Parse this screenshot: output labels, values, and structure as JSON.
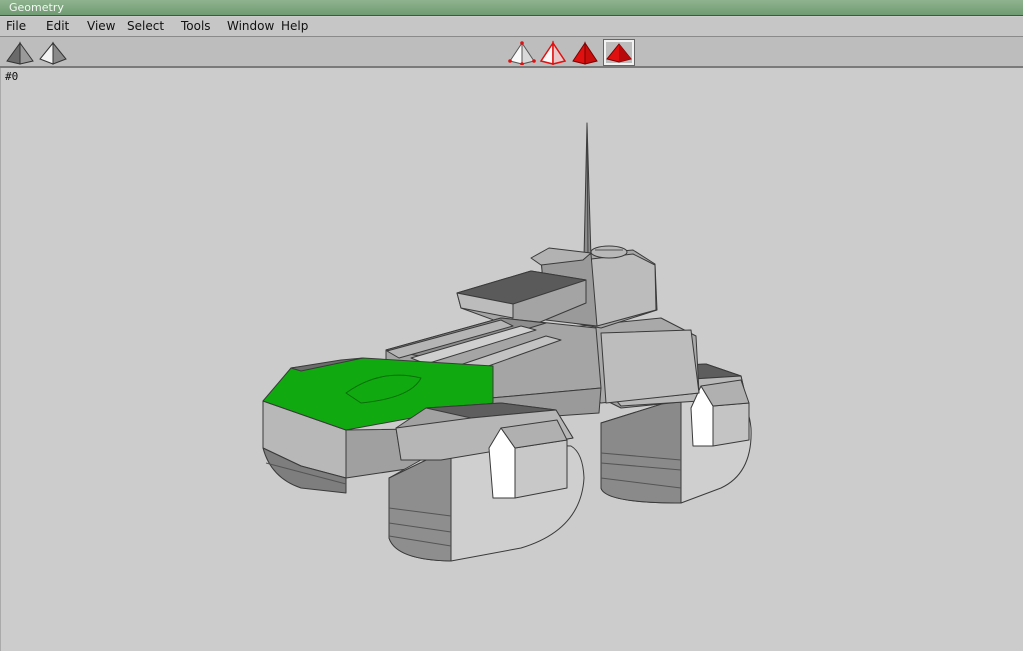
{
  "window": {
    "title": "Geometry"
  },
  "menu": {
    "items": [
      "File",
      "Edit",
      "View",
      "Select",
      "Tools",
      "Window",
      "Help"
    ]
  },
  "toolbar": {
    "left_tools": [
      "shaded-pyramid-icon",
      "wire-shaded-pyramid-icon"
    ],
    "center_tools": [
      "vertex-select-icon",
      "edge-select-icon",
      "face-select-icon",
      "object-select-icon"
    ],
    "active_center_tool": 3,
    "colors": {
      "accent": "#e01010",
      "selection_face": "#0aa20a"
    }
  },
  "viewport": {
    "object_label": "#0"
  }
}
